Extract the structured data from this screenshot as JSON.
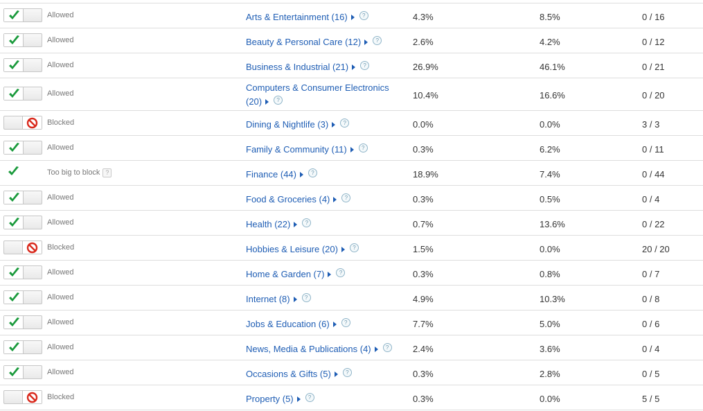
{
  "colors": {
    "link": "#1e5db4",
    "allowed_check": "#1a9a3c",
    "blocked_icon": "#d9291c",
    "divider": "#dddddd"
  },
  "icons": {
    "allowed": "checkmark-icon",
    "blocked": "no-entry-icon",
    "expand": "triangle-right-icon",
    "help": "question-mark-icon"
  },
  "rows": [
    {
      "state": "allowed",
      "status": "Allowed",
      "category": "Arts & Entertainment (16)",
      "pct1": "4.3%",
      "pct2": "8.5%",
      "ratio": "0 / 16"
    },
    {
      "state": "allowed",
      "status": "Allowed",
      "category": "Beauty & Personal Care (12)",
      "pct1": "2.6%",
      "pct2": "4.2%",
      "ratio": "0 / 12"
    },
    {
      "state": "allowed",
      "status": "Allowed",
      "category": "Business & Industrial (21)",
      "pct1": "26.9%",
      "pct2": "46.1%",
      "ratio": "0 / 21"
    },
    {
      "state": "allowed",
      "status": "Allowed",
      "category": "Computers & Consumer Electronics (20)",
      "pct1": "10.4%",
      "pct2": "16.6%",
      "ratio": "0 / 20"
    },
    {
      "state": "blocked",
      "status": "Blocked",
      "category": "Dining & Nightlife (3)",
      "pct1": "0.0%",
      "pct2": "0.0%",
      "ratio": "3 / 3"
    },
    {
      "state": "allowed",
      "status": "Allowed",
      "category": "Family & Community (11)",
      "pct1": "0.3%",
      "pct2": "6.2%",
      "ratio": "0 / 11"
    },
    {
      "state": "fixed",
      "status": "Too big to block",
      "status_help": "?",
      "category": "Finance (44)",
      "pct1": "18.9%",
      "pct2": "7.4%",
      "ratio": "0 / 44"
    },
    {
      "state": "allowed",
      "status": "Allowed",
      "category": "Food & Groceries (4)",
      "pct1": "0.3%",
      "pct2": "0.5%",
      "ratio": "0 / 4"
    },
    {
      "state": "allowed",
      "status": "Allowed",
      "category": "Health (22)",
      "pct1": "0.7%",
      "pct2": "13.6%",
      "ratio": "0 / 22"
    },
    {
      "state": "blocked",
      "status": "Blocked",
      "category": "Hobbies & Leisure (20)",
      "pct1": "1.5%",
      "pct2": "0.0%",
      "ratio": "20 / 20"
    },
    {
      "state": "allowed",
      "status": "Allowed",
      "category": "Home & Garden (7)",
      "pct1": "0.3%",
      "pct2": "0.8%",
      "ratio": "0 / 7"
    },
    {
      "state": "allowed",
      "status": "Allowed",
      "category": "Internet (8)",
      "pct1": "4.9%",
      "pct2": "10.3%",
      "ratio": "0 / 8"
    },
    {
      "state": "allowed",
      "status": "Allowed",
      "category": "Jobs & Education (6)",
      "pct1": "7.7%",
      "pct2": "5.0%",
      "ratio": "0 / 6"
    },
    {
      "state": "allowed",
      "status": "Allowed",
      "category": "News, Media & Publications (4)",
      "pct1": "2.4%",
      "pct2": "3.6%",
      "ratio": "0 / 4"
    },
    {
      "state": "allowed",
      "status": "Allowed",
      "category": "Occasions & Gifts (5)",
      "pct1": "0.3%",
      "pct2": "2.8%",
      "ratio": "0 / 5"
    },
    {
      "state": "blocked",
      "status": "Blocked",
      "category": "Property (5)",
      "pct1": "0.3%",
      "pct2": "0.0%",
      "ratio": "5 / 5"
    }
  ],
  "help_glyph": "?"
}
